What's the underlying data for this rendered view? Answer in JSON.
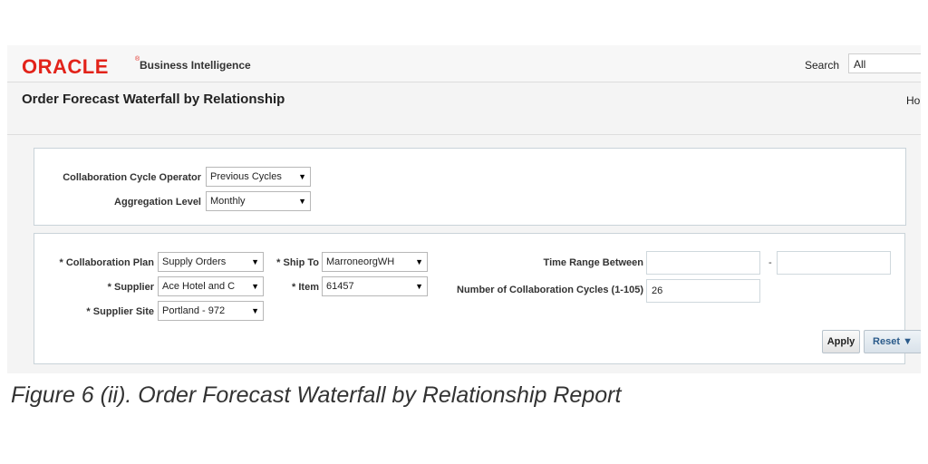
{
  "header": {
    "logo_text": "ORACLE",
    "logo_reg": "®",
    "product": "Business Intelligence",
    "search_label": "Search",
    "search_value": "All",
    "brand_color": "#e2231a"
  },
  "page": {
    "title": "Order Forecast Waterfall by Relationship",
    "home_link": "Ho"
  },
  "prompts_top": {
    "operator_label": "Collaboration Cycle Operator",
    "operator_value": "Previous Cycles",
    "aggregation_label": "Aggregation Level",
    "aggregation_value": "Monthly"
  },
  "prompts_main": {
    "plan_label": "* Collaboration Plan",
    "plan_value": "Supply Orders",
    "supplier_label": "* Supplier",
    "supplier_value": "Ace Hotel and C",
    "supplier_site_label": "* Supplier Site",
    "supplier_site_value": "Portland - 972",
    "ship_to_label": "* Ship To",
    "ship_to_value": "MarroneorgWH",
    "item_label": "* Item",
    "item_value": "61457",
    "time_range_label": "Time Range Between",
    "time_range_from": "",
    "time_range_sep": "-",
    "time_range_to": "",
    "cycles_label": "Number of Collaboration Cycles (1-105)",
    "cycles_value": "26"
  },
  "buttons": {
    "apply": "Apply",
    "reset": "Reset ▼"
  },
  "icons": {
    "dropdown_arrow": "▼"
  },
  "caption": "Figure 6 (ii). Order Forecast Waterfall by Relationship Report"
}
